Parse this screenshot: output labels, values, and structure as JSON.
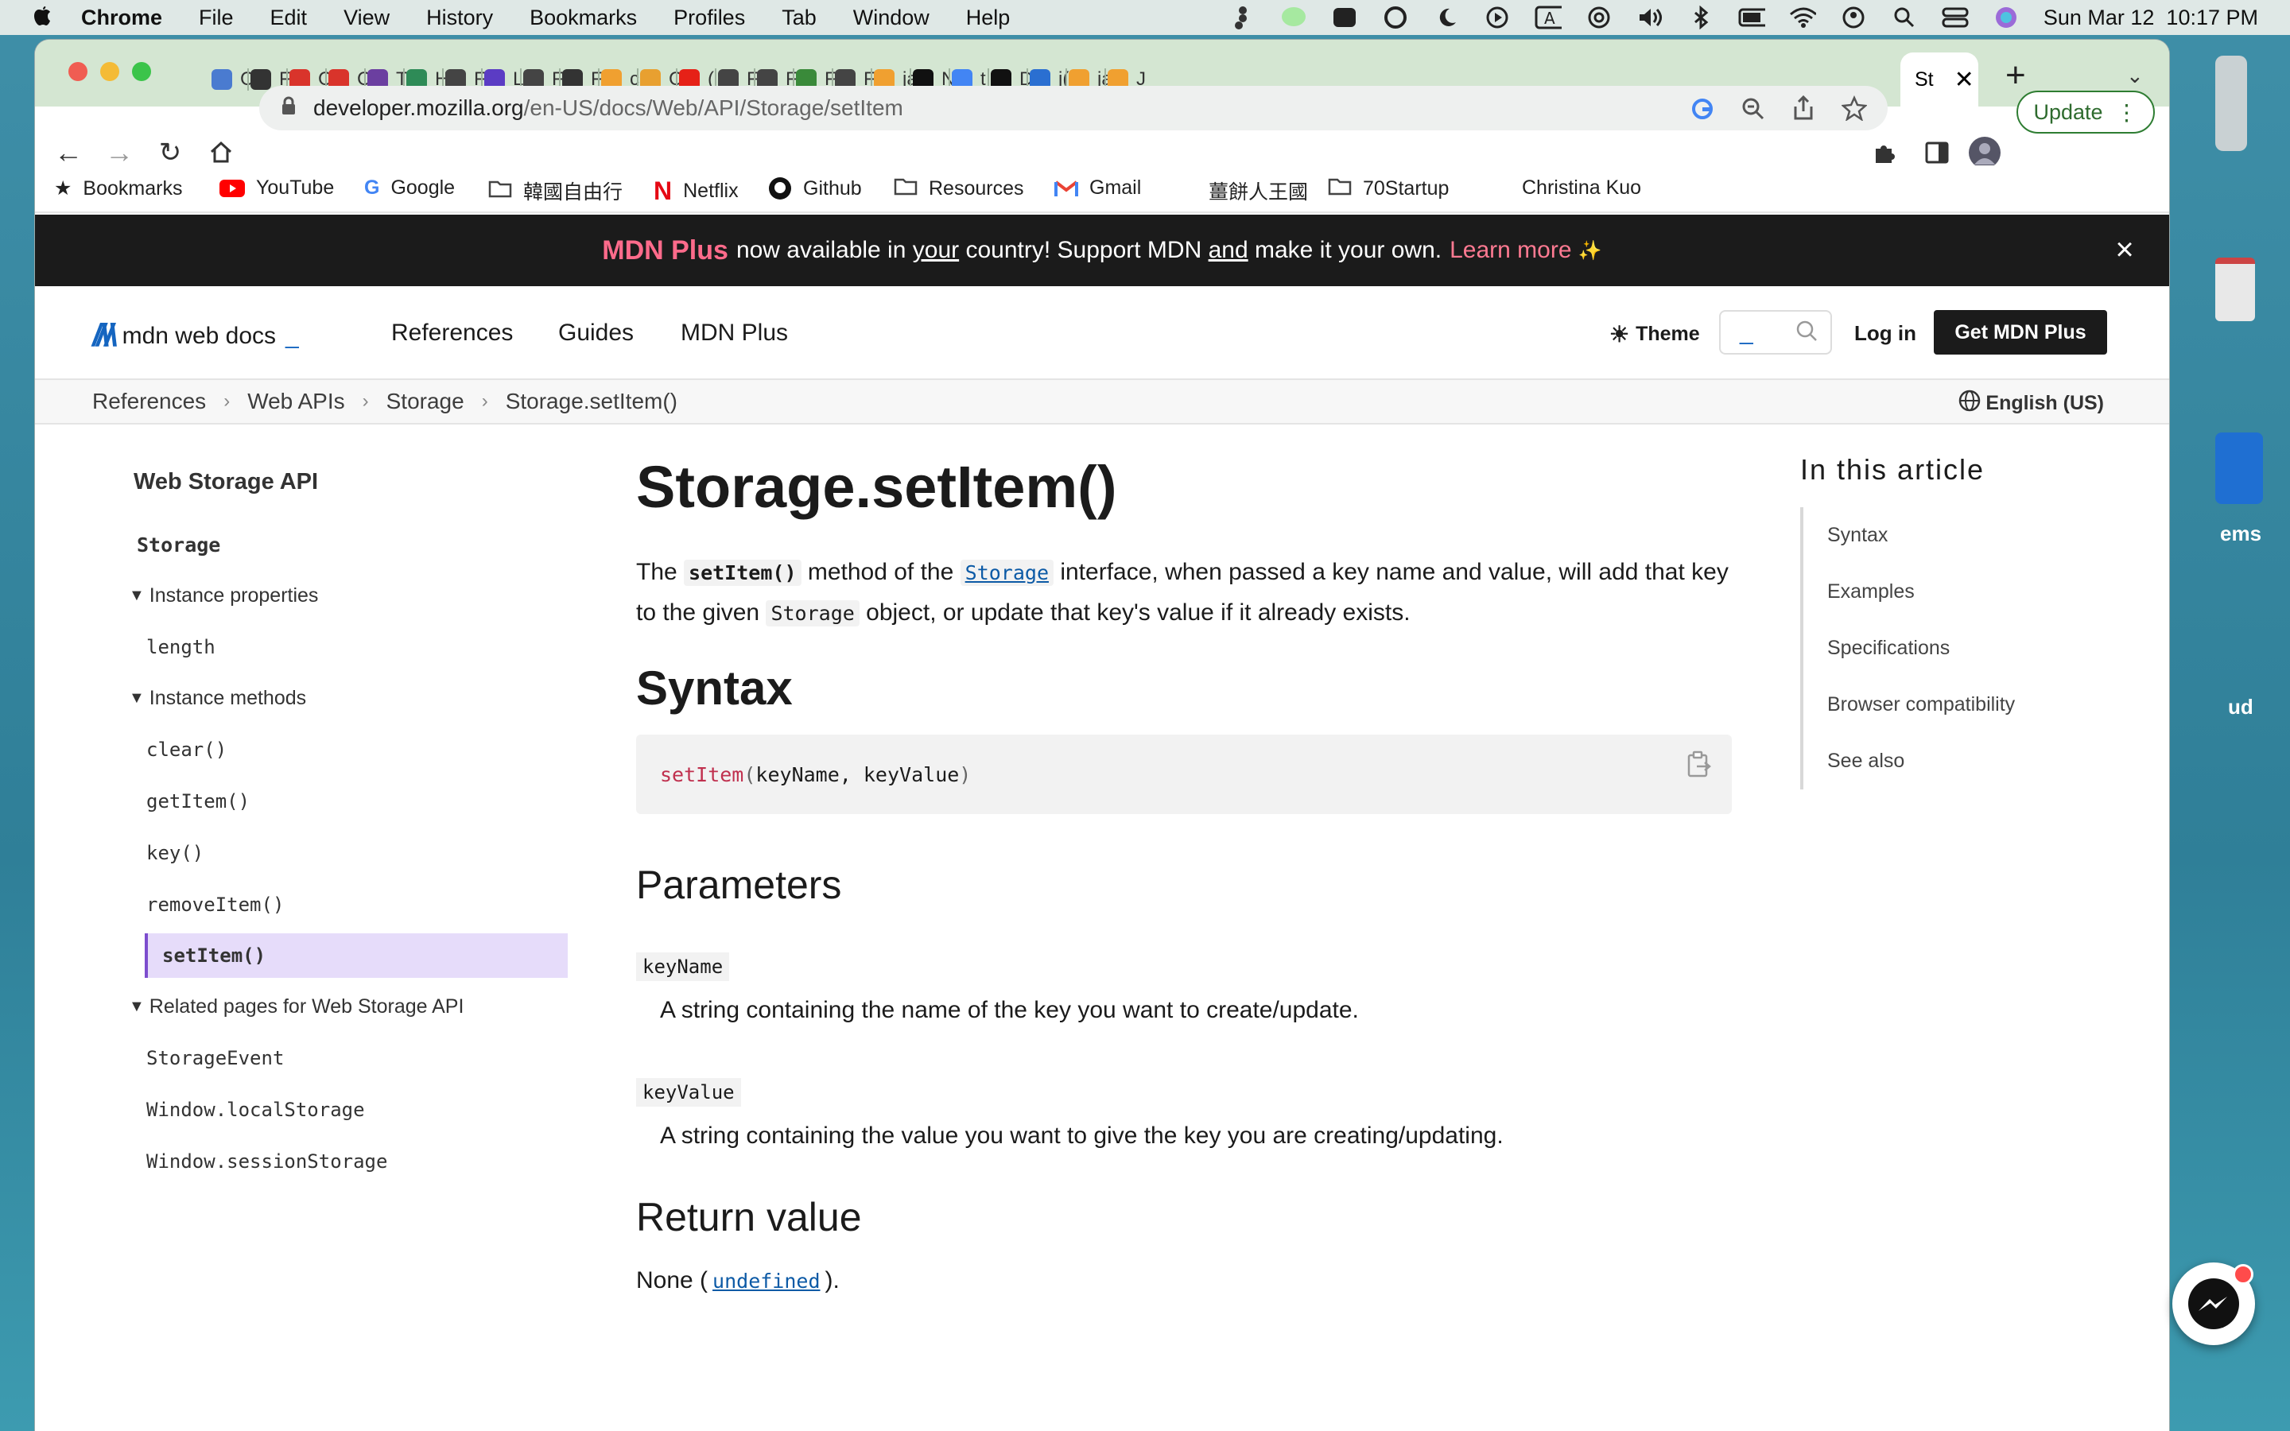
{
  "menubar": {
    "app": "Chrome",
    "items": [
      "File",
      "Edit",
      "View",
      "History",
      "Bookmarks",
      "Profiles",
      "Tab",
      "Window",
      "Help"
    ],
    "clock": "Sun Mar 12  10:17 PM"
  },
  "desktop": {
    "labels": [
      "ems",
      "ud"
    ]
  },
  "browser": {
    "tabs": [
      "C",
      "F",
      "C",
      "C",
      "T",
      "H",
      "F",
      "L",
      "F",
      "F",
      "c",
      "C",
      "(",
      "F",
      "F",
      "F",
      "F",
      "ja",
      "N",
      "t",
      "D",
      "j(",
      "ja",
      "J"
    ],
    "active_tab": "St",
    "url_host": "developer.mozilla.org",
    "url_path": "/en-US/docs/Web/API/Storage/setItem",
    "update_label": "Update",
    "bookmarks": [
      "Bookmarks",
      "YouTube",
      "Google",
      "韓國自由行",
      "Netflix",
      "Github",
      "Resources",
      "Gmail",
      "薑餅人王國",
      "70Startup",
      "Christina Kuo"
    ]
  },
  "banner": {
    "plus": "MDN Plus",
    "t1": "now available in",
    "u1": "your",
    "t2": "country! Support MDN",
    "u2": "and",
    "t3": "make it your own.",
    "learn": "Learn more",
    "sparkle": "✨"
  },
  "nav": {
    "logo": "mdn web docs",
    "links": [
      "References",
      "Guides",
      "MDN Plus"
    ],
    "theme": "Theme",
    "login": "Log in",
    "get_plus": "Get MDN Plus"
  },
  "breadcrumbs": [
    "References",
    "Web APIs",
    "Storage",
    "Storage.setItem()"
  ],
  "language": "English (US)",
  "sidebar": {
    "title": "Web Storage API",
    "storage": "Storage",
    "instance_properties": "Instance properties",
    "properties": [
      "length"
    ],
    "instance_methods": "Instance methods",
    "methods": [
      "clear()",
      "getItem()",
      "key()",
      "removeItem()",
      "setItem()"
    ],
    "related": "Related pages for Web Storage API",
    "related_items": [
      "StorageEvent",
      "Window.localStorage",
      "Window.sessionStorage"
    ]
  },
  "article": {
    "title": "Storage.setItem()",
    "intro_1": "The ",
    "intro_code1": "setItem()",
    "intro_2": " method of the ",
    "intro_link": "Storage",
    "intro_3": " interface, when passed a key name and value, will add that key to the given ",
    "intro_code2": "Storage",
    "intro_4": " object, or update that key's value if it already exists.",
    "syntax_heading": "Syntax",
    "syntax_fn": "setItem",
    "syntax_args": "keyName, keyValue",
    "params_heading": "Parameters",
    "params": [
      {
        "name": "keyName",
        "desc": "A string containing the name of the key you want to create/update."
      },
      {
        "name": "keyValue",
        "desc": "A string containing the value you want to give the key you are creating/updating."
      }
    ],
    "return_heading": "Return value",
    "return_text": "None (",
    "return_link": "undefined",
    "return_end": ")."
  },
  "toc": {
    "title": "In this article",
    "items": [
      "Syntax",
      "Examples",
      "Specifications",
      "Browser compatibility",
      "See also"
    ]
  }
}
